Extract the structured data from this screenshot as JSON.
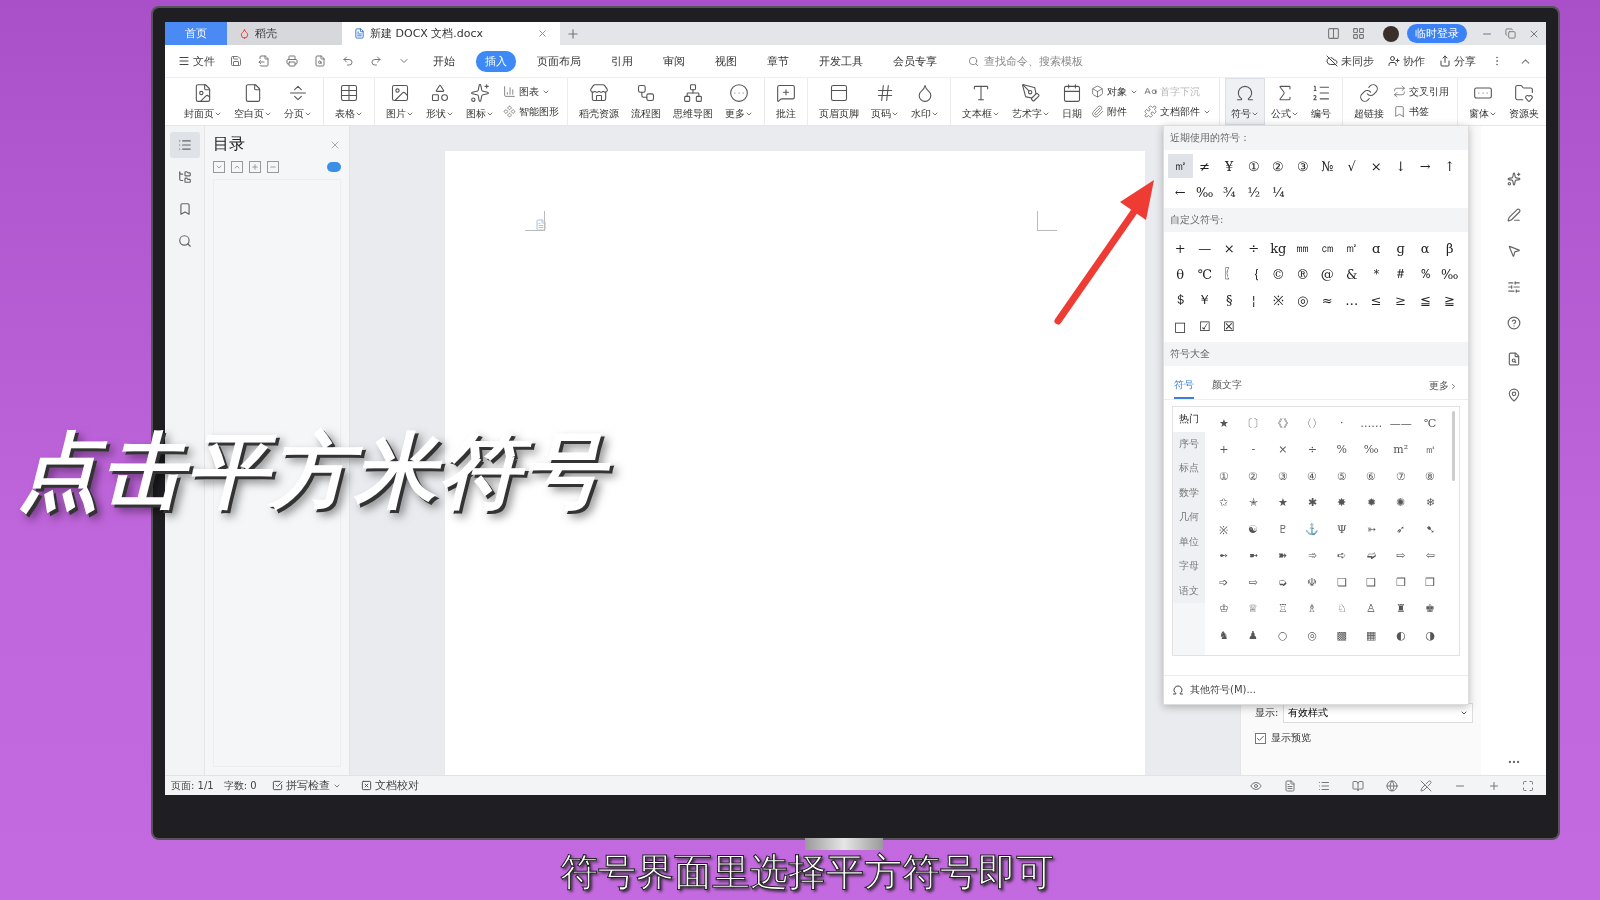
{
  "tabs": [
    {
      "label": "首页",
      "kind": "home",
      "selected": false
    },
    {
      "label": "稻壳",
      "kind": "app",
      "selected": false
    },
    {
      "label": "新建 DOCX 文档.docx",
      "kind": "doc",
      "selected": true
    }
  ],
  "account": {
    "login": "临时登录"
  },
  "menu": {
    "file": "文件",
    "items": [
      {
        "label": "开始",
        "selected": false
      },
      {
        "label": "插入",
        "selected": true
      },
      {
        "label": "页面布局",
        "selected": false
      },
      {
        "label": "引用",
        "selected": false
      },
      {
        "label": "审阅",
        "selected": false
      },
      {
        "label": "视图",
        "selected": false
      },
      {
        "label": "章节",
        "selected": false
      },
      {
        "label": "开发工具",
        "selected": false
      },
      {
        "label": "会员专享",
        "selected": false
      }
    ],
    "search": {
      "placeholder": "查找命令、搜索模板"
    },
    "actions": [
      "未同步",
      "协作",
      "分享"
    ]
  },
  "ribbon": {
    "groups": [
      [
        {
          "kind": "large",
          "label": "封面页",
          "dropdown": true
        },
        {
          "kind": "large",
          "label": "空白页",
          "dropdown": true
        },
        {
          "kind": "large",
          "label": "分页",
          "dropdown": true
        }
      ],
      [
        {
          "kind": "large",
          "label": "表格",
          "dropdown": true
        }
      ],
      [
        {
          "kind": "large",
          "label": "图片",
          "dropdown": true
        },
        {
          "kind": "large",
          "label": "形状",
          "dropdown": true
        },
        {
          "kind": "large",
          "label": "图标",
          "dropdown": true
        },
        {
          "kind": "stack",
          "items": [
            {
              "label": "图表",
              "dropdown": true,
              "disabled": false
            },
            {
              "label": "智能图形",
              "dropdown": false,
              "disabled": false
            }
          ]
        }
      ],
      [
        {
          "kind": "large",
          "label": "稻壳资源",
          "dropdown": false
        },
        {
          "kind": "large",
          "label": "流程图",
          "dropdown": false
        },
        {
          "kind": "large",
          "label": "思维导图",
          "dropdown": false
        },
        {
          "kind": "large",
          "label": "更多",
          "dropdown": true
        }
      ],
      [
        {
          "kind": "large",
          "label": "批注",
          "dropdown": false
        }
      ],
      [
        {
          "kind": "large",
          "label": "页眉页脚",
          "dropdown": false
        },
        {
          "kind": "large",
          "label": "页码",
          "dropdown": true
        },
        {
          "kind": "large",
          "label": "水印",
          "dropdown": true
        }
      ],
      [
        {
          "kind": "large",
          "label": "文本框",
          "dropdown": true
        },
        {
          "kind": "large",
          "label": "艺术字",
          "dropdown": true
        },
        {
          "kind": "large",
          "label": "日期",
          "dropdown": false
        },
        {
          "kind": "stack",
          "items": [
            {
              "label": "对象",
              "dropdown": true,
              "disabled": false
            },
            {
              "label": "附件",
              "dropdown": false,
              "disabled": false
            }
          ]
        },
        {
          "kind": "stack",
          "items": [
            {
              "label": "首字下沉",
              "dropdown": false,
              "disabled": true
            },
            {
              "label": "文档部件",
              "dropdown": true,
              "disabled": false
            }
          ]
        }
      ],
      [
        {
          "kind": "large",
          "label": "符号",
          "dropdown": true,
          "selected": true
        },
        {
          "kind": "large",
          "label": "公式",
          "dropdown": true,
          "selected": false
        },
        {
          "kind": "large",
          "label": "编号",
          "dropdown": false,
          "selected": false
        }
      ],
      [
        {
          "kind": "large",
          "label": "超链接",
          "dropdown": false
        },
        {
          "kind": "stack",
          "items": [
            {
              "label": "交叉引用",
              "dropdown": false,
              "disabled": false
            },
            {
              "label": "书签",
              "dropdown": false,
              "disabled": false
            }
          ]
        }
      ],
      [
        {
          "kind": "large",
          "label": "窗体",
          "dropdown": true
        },
        {
          "kind": "large",
          "label": "资源夹",
          "dropdown": false
        }
      ]
    ]
  },
  "toc": {
    "title": "目录"
  },
  "symbol_panel": {
    "recent_title": "近期使用的符号：",
    "recent": [
      {
        "symbol": "㎡",
        "selected": true
      },
      {
        "symbol": "≠",
        "selected": false
      },
      {
        "symbol": "¥",
        "selected": false
      },
      {
        "symbol": "①",
        "selected": false
      },
      {
        "symbol": "②",
        "selected": false
      },
      {
        "symbol": "③",
        "selected": false
      },
      {
        "symbol": "№",
        "selected": false
      },
      {
        "symbol": "√",
        "selected": false
      },
      {
        "symbol": "×",
        "selected": false
      },
      {
        "symbol": "↓",
        "selected": false
      },
      {
        "symbol": "→",
        "selected": false
      },
      {
        "symbol": "↑",
        "selected": false
      },
      {
        "symbol": "←",
        "selected": false
      },
      {
        "symbol": "‰",
        "selected": false
      },
      {
        "symbol": "¾",
        "selected": false
      },
      {
        "symbol": "½",
        "selected": false
      },
      {
        "symbol": "¼",
        "selected": false
      }
    ],
    "custom_title": "自定义符号:",
    "custom": [
      "+",
      "—",
      "×",
      "÷",
      "kg",
      "㎜",
      "㎝",
      "㎡",
      "ɑ",
      "ɡ",
      "α",
      "β",
      "θ",
      "℃",
      "〖",
      "｛",
      "©",
      "®",
      "@",
      "&",
      "＊",
      "＃",
      "％",
      "‰",
      "＄",
      "￥",
      "§",
      "¦",
      "※",
      "◎",
      "≈",
      "…",
      "≤",
      "≥",
      "≦",
      "≧",
      "□",
      "☑",
      "☒"
    ],
    "all_title": "符号大全",
    "tabs": [
      {
        "label": "符号",
        "selected": true
      },
      {
        "label": "颜文字",
        "selected": false
      }
    ],
    "more": "更多",
    "categories": [
      {
        "label": "热门",
        "selected": true
      },
      {
        "label": "序号",
        "selected": false
      },
      {
        "label": "标点",
        "selected": false
      },
      {
        "label": "数学",
        "selected": false
      },
      {
        "label": "几何",
        "selected": false
      },
      {
        "label": "单位",
        "selected": false
      },
      {
        "label": "字母",
        "selected": false
      },
      {
        "label": "语文",
        "selected": false
      }
    ],
    "grid": [
      [
        "★",
        "〔〕",
        "《》",
        "〈〉",
        "·",
        "……",
        "——",
        "℃"
      ],
      [
        "+",
        "-",
        "×",
        "÷",
        "%",
        "‰",
        "m²",
        "㎡"
      ],
      [
        "①",
        "②",
        "③",
        "④",
        "⑤",
        "⑥",
        "⑦",
        "⑧"
      ],
      [
        "✩",
        "✭",
        "★",
        "✱",
        "✸",
        "✹",
        "✺",
        "❄"
      ],
      [
        "※",
        "☯",
        "♇",
        "⚓",
        "Ψ",
        "➳",
        "➶",
        "➷"
      ],
      [
        "➻",
        "➼",
        "➽",
        "➾",
        "➪",
        "➫",
        "⇨",
        "⇦"
      ],
      [
        "➩",
        "⇨",
        "➭",
        "☫",
        "❏",
        "❑",
        "❐",
        "❒"
      ],
      [
        "♔",
        "♕",
        "♖",
        "♗",
        "♘",
        "♙",
        "♜",
        "♚"
      ],
      [
        "♞",
        "♟",
        "○",
        "◎",
        "▩",
        "▦",
        "◐",
        "◑"
      ]
    ],
    "footer": "其他符号(M)..."
  },
  "style_pane": {
    "show_label": "显示:",
    "show_value": "有效样式",
    "preview": {
      "label": "显示预览",
      "checked": true
    }
  },
  "status_bar": {
    "page": "页面: 1/1",
    "words": "字数: 0",
    "spell": "拼写检查",
    "proofread": "文档校对"
  },
  "captions": {
    "headline": "点击平方米符号",
    "subtitle": "符号界面里选择平方符号即可"
  }
}
